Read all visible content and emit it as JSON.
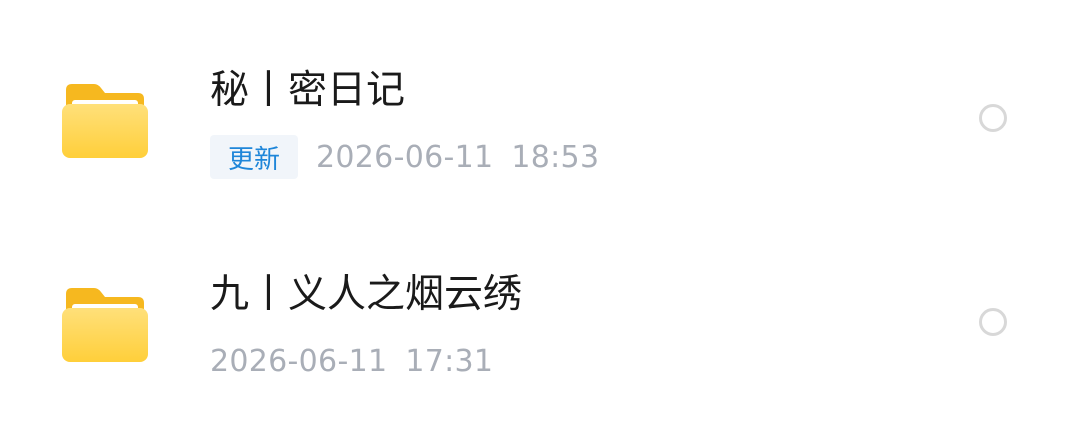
{
  "items": [
    {
      "title": "秘丨密日记",
      "badge": "更新",
      "date": "2026-06-11",
      "time": "18:53"
    },
    {
      "title": "九丨义人之烟云绣",
      "date": "2026-06-11",
      "time": "17:31"
    }
  ],
  "icons": {
    "folder": "folder-icon",
    "select": "radio-circle-icon"
  },
  "colors": {
    "folder_yellow": "#FFD54A",
    "badge_text": "#1F86D9",
    "timestamp": "#A9AEB7"
  }
}
